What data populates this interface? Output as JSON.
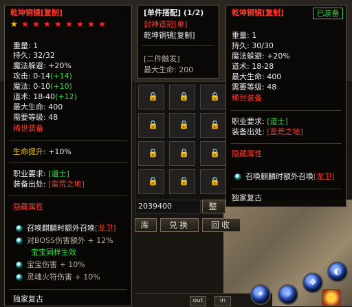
{
  "tip_left": {
    "title": "乾坤铜镜[复制]",
    "stars": {
      "gold": 1,
      "red": 8
    },
    "stats": [
      {
        "label": "重量",
        "value": ": 1",
        "bonus": ""
      },
      {
        "label": "持久",
        "value": ": 32/32",
        "bonus": ""
      },
      {
        "label": "魔法躲避",
        "value": ": +20%",
        "bonus": ""
      },
      {
        "label": "攻击",
        "value": ": 0-14",
        "bonus": "(+14)"
      },
      {
        "label": "魔法",
        "value": ": 0-10",
        "bonus": "(+10)"
      },
      {
        "label": "道术",
        "value": ": 18-40",
        "bonus": "(+12)"
      },
      {
        "label": "最大生命",
        "value": ": 400",
        "bonus": ""
      },
      {
        "label": "需要等级",
        "value": ": 48",
        "bonus": ""
      }
    ],
    "set_label": "稀世装备",
    "life_boost_label": "生命提升",
    "life_boost_value": ": +10%",
    "req_label": "职业要求:",
    "req_value": "[道士]",
    "source_label": "装备出处:",
    "source_value": "[蛮荒之地]",
    "hidden_header": "隐藏属性",
    "hidden_items": [
      {
        "text": "召唤麒麟时额外召唤",
        "tag": "[龙卫]",
        "style": "white"
      },
      {
        "text": "对BOSS伤害额外 + 12%",
        "tag": "",
        "style": "gray"
      },
      {
        "text": "宝宝同样生效",
        "tag": "",
        "style": "green"
      },
      {
        "text": "宝宝伤害 + 10%",
        "tag": "",
        "style": "gray"
      },
      {
        "text": "灵魂火符伤害 + 10%",
        "tag": "",
        "style": "gray"
      }
    ],
    "footer": "独家复古"
  },
  "tip_mid": {
    "title": "[单件搭配] (1/2)",
    "line1": "封神道冠[单]",
    "line2": "乾坤铜镜[复制]",
    "trigger": "[二件触发]",
    "max_life": "最大生命: 200"
  },
  "tip_right": {
    "title": "乾坤铜镜[复制]",
    "badge": "已装备",
    "stats": [
      "重量: 1",
      "持久: 30/30",
      "魔法躲避: +20%",
      "道术: 18-28",
      "最大生命: 400",
      "需要等级: 48"
    ],
    "set_label": "稀世装备",
    "req_label": "职业要求:",
    "req_value": "[道士]",
    "source_label": "装备出处:",
    "source_value": "[蛮荒之地]",
    "hidden_header": "隐藏属性",
    "hidden_item": "召唤麒麟时额外召唤",
    "hidden_tag": "[龙卫]",
    "footer": "独家复古"
  },
  "scene": {
    "gold_amount": "2039400",
    "btn_1": "整",
    "btn_2": "库",
    "btn_3": "兑换",
    "btn_4": "回收",
    "out_label": "out",
    "in_label": "in"
  },
  "colors": {
    "red": "#ff3b2f",
    "green": "#31e040",
    "gold": "#f3c21b",
    "badge_green": "#38d24a"
  }
}
